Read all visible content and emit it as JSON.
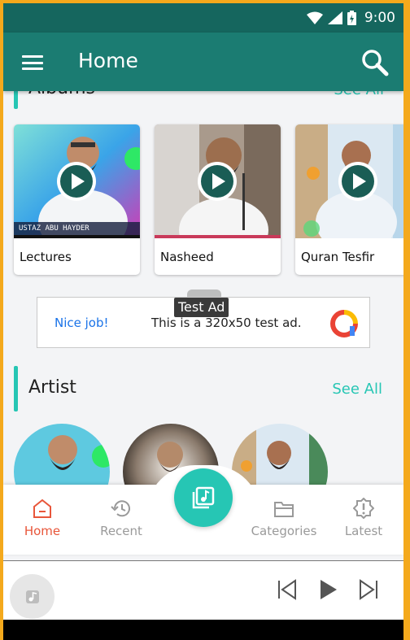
{
  "status_bar": {
    "time": "9:00"
  },
  "app_bar": {
    "title": "Home"
  },
  "albums": {
    "title": "Albums",
    "see_all": "See All",
    "cards": [
      {
        "label": "Lectures",
        "thumb_caption": "USTAZ ABU HAYDER"
      },
      {
        "label": "Nasheed"
      },
      {
        "label": "Quran Tesfir"
      }
    ]
  },
  "ad": {
    "tag": "Test Ad",
    "nice": "Nice job!",
    "message": "This is a 320x50 test ad."
  },
  "artist": {
    "title": "Artist",
    "see_all": "See All"
  },
  "bottom_nav": {
    "items": [
      {
        "label": "Home",
        "icon": "home-icon",
        "active": true
      },
      {
        "label": "Recent",
        "icon": "history-icon",
        "active": false
      },
      {
        "label": "Categories",
        "icon": "folder-icon",
        "active": false
      },
      {
        "label": "Latest",
        "icon": "badge-alert-icon",
        "active": false
      }
    ],
    "center_icon": "music-library-icon"
  },
  "player": {
    "icons": [
      "music-note-icon",
      "skip-previous-icon",
      "play-icon",
      "skip-next-icon"
    ]
  },
  "colors": {
    "primary": "#1b7c72",
    "status_bar": "#15665e",
    "accent": "#26c6b4",
    "active_nav": "#e8563a",
    "link_blue": "#1a73e8"
  }
}
